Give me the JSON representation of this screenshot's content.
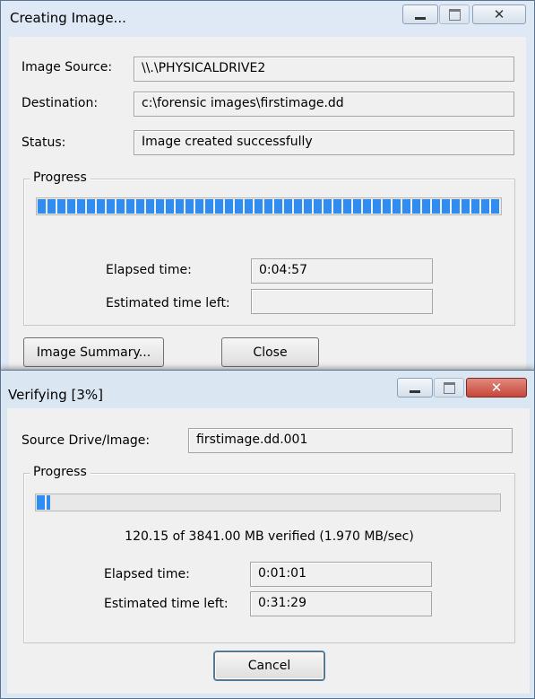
{
  "window1": {
    "title": "Creating Image...",
    "image_source_label": "Image Source:",
    "image_source_value": "\\\\.\\PHYSICALDRIVE2",
    "destination_label": "Destination:",
    "destination_value": "c:\\forensic images\\firstimage.dd",
    "status_label": "Status:",
    "status_value": "Image created successfully",
    "progress_legend": "Progress",
    "progress_fraction": 1.0,
    "elapsed_label": "Elapsed time:",
    "elapsed_value": "0:04:57",
    "estimated_label": "Estimated time left:",
    "estimated_value": "",
    "summary_button": "Image Summary...",
    "close_button": "Close"
  },
  "window2": {
    "title": "Verifying [3%]",
    "source_label": "Source Drive/Image:",
    "source_value": "firstimage.dd.001",
    "progress_legend": "Progress",
    "progress_fraction": 0.03,
    "verified_text": "120.15 of 3841.00 MB verified (1.970 MB/sec)",
    "elapsed_label": "Elapsed time:",
    "elapsed_value": "0:01:01",
    "estimated_label": "Estimated time left:",
    "estimated_value": "0:31:29",
    "cancel_button": "Cancel"
  },
  "colors": {
    "progress_fill": "#2f8cf0",
    "close_caption": "#c7463a"
  }
}
